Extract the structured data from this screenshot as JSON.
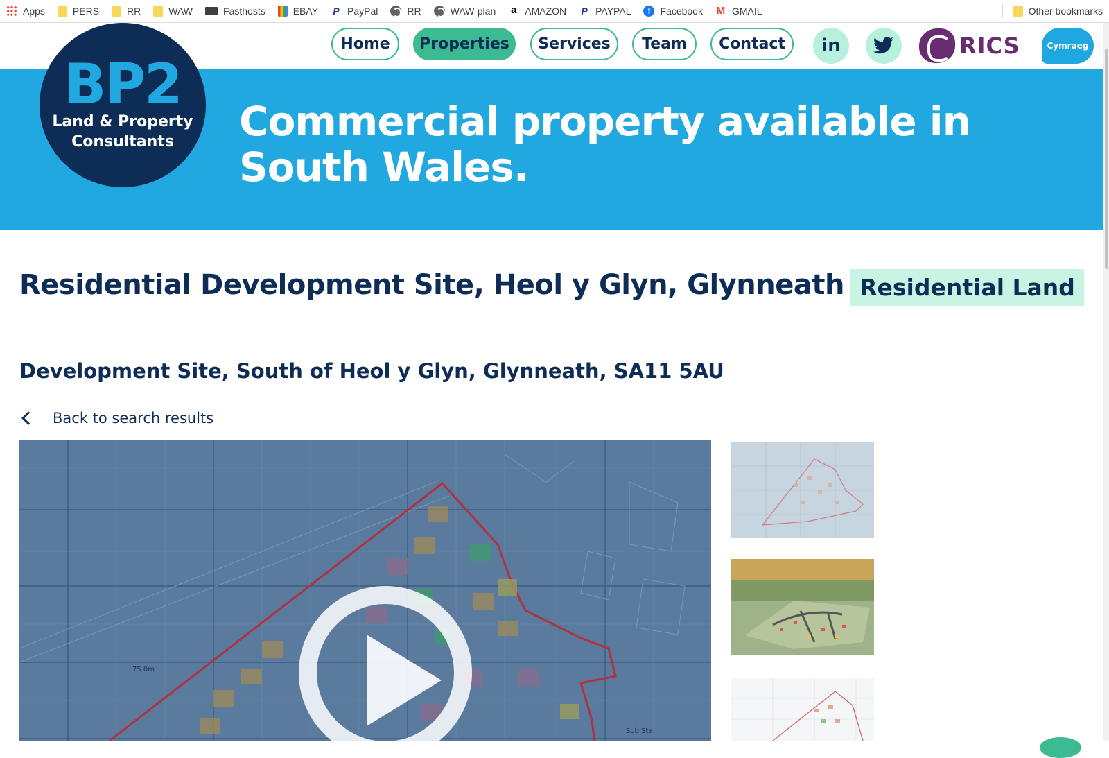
{
  "bookmarks": {
    "items": [
      {
        "label": "Apps",
        "icon": "apps-grid-icon"
      },
      {
        "label": "PERS",
        "icon": "folder-icon"
      },
      {
        "label": "RR",
        "icon": "folder-icon"
      },
      {
        "label": "WAW",
        "icon": "folder-icon"
      },
      {
        "label": "Fasthosts",
        "icon": "mail-icon"
      },
      {
        "label": "EBAY",
        "icon": "shopping-bag-icon"
      },
      {
        "label": "PayPal",
        "icon": "paypal-icon"
      },
      {
        "label": "RR",
        "icon": "globe-icon"
      },
      {
        "label": "WAW-plan",
        "icon": "globe-icon"
      },
      {
        "label": "AMAZON",
        "icon": "amazon-icon"
      },
      {
        "label": "PAYPAL",
        "icon": "paypal-icon"
      },
      {
        "label": "Facebook",
        "icon": "facebook-icon"
      },
      {
        "label": "GMAIL",
        "icon": "gmail-icon"
      }
    ],
    "other": "Other bookmarks"
  },
  "nav": {
    "home": "Home",
    "properties": "Properties",
    "services": "Services",
    "team": "Team",
    "contact": "Contact",
    "linkedin": "in",
    "rics": "RICS",
    "cymraeg": "Cymraeg"
  },
  "logo": {
    "main": "BP2",
    "line1": "Land & Property",
    "line2": "Consultants"
  },
  "hero": {
    "title": "Commercial property available in South Wales."
  },
  "property": {
    "title": "Residential Development Site, Heol y Glyn, Glynneath",
    "badge": "Residential Land",
    "address": "Development Site, South of Heol y Glyn, Glynneath, SA11 5AU",
    "back": "Back to search results"
  },
  "map_labels": {
    "elevation": "75.0m",
    "substation": "Sub Sta"
  },
  "colors": {
    "navy": "#0e2d56",
    "hero_blue": "#22a8e0",
    "green": "#3cba92",
    "mint": "#c8f5e3",
    "rics_purple": "#6a2c70"
  }
}
